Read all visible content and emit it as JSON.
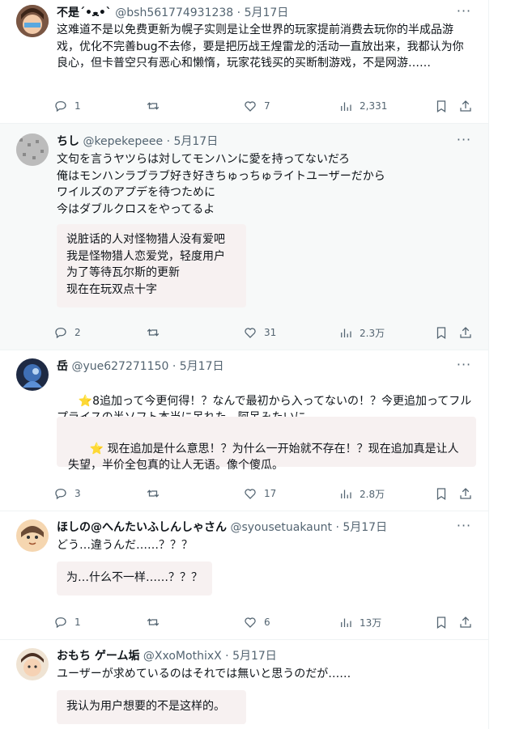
{
  "posts": [
    {
      "name": "不是´•ﻌ•`",
      "handle": "@bsh561774931238",
      "date": "5月17日",
      "text": "这难道不是以免费更新为幌子实则是让全世界的玩家提前消费去玩你的半成品游戏，优化不完善bug不去修，要是把历战王煌雷龙的活动一直放出来，我都认为你良心，但卡普空只有恶心和懒惰，玩家花钱买的买断制游戏，不是网游……",
      "translation": "",
      "replies": "1",
      "retweets": "",
      "likes": "7",
      "views": "2,331"
    },
    {
      "name": "ちし",
      "handle": "@kepekepeee",
      "date": "5月17日",
      "text": "文句を言うヤツらは対してモンハンに愛を持ってないだろ\n俺はモンハンラブラブ好き好きちゅっちゅライトユーザーだから\nワイルズのアプデを待つために\n今はダブルクロスをやってるよ",
      "translation": "说脏话的人对怪物猎人没有爱吧\n我是怪物猎人恋爱党，轻度用户\n为了等待瓦尔斯的更新\n现在在玩双点十字",
      "replies": "2",
      "retweets": "",
      "likes": "31",
      "views": "2.3万"
    },
    {
      "name": "岳",
      "handle": "@yue627271150",
      "date": "5月17日",
      "text_star": "⭐",
      "text": "8追加って今更何得！？なんで最初から入ってないの！？今更追加ってフルプライスの半ソフト本当に呆れた。阿呆みたいに。",
      "translation_star": "⭐",
      "translation": " 现在追加是什么意思！？为什么一开始就不存在！？现在追加真是让人失望，半价全包真的让人无语。像个傻瓜。",
      "replies": "3",
      "retweets": "",
      "likes": "17",
      "views": "2.8万"
    },
    {
      "name": "ほしの@へんたいふしんしゃさん",
      "handle": "@syousetuakaunt",
      "date": "5月17日",
      "text": "どう…違うんだ……？？？",
      "translation": "为…什么不一样……？？？",
      "replies": "1",
      "retweets": "",
      "likes": "6",
      "views": "13万"
    },
    {
      "name": "おもち ゲーム垢",
      "handle": "@XxoMothixX",
      "date": "5月17日",
      "text": "ユーザーが求めているのはそれでは無いと思うのだが……",
      "translation": "我认为用户想要的不是这样的。",
      "replies": "",
      "retweets": "",
      "likes": "",
      "views": ""
    }
  ],
  "separator": "·",
  "more_glyph": "···",
  "colors": {
    "text": "#0f1419",
    "muted": "#536471",
    "translation_bg": "#f7f1f1",
    "border": "#eff3f4"
  }
}
